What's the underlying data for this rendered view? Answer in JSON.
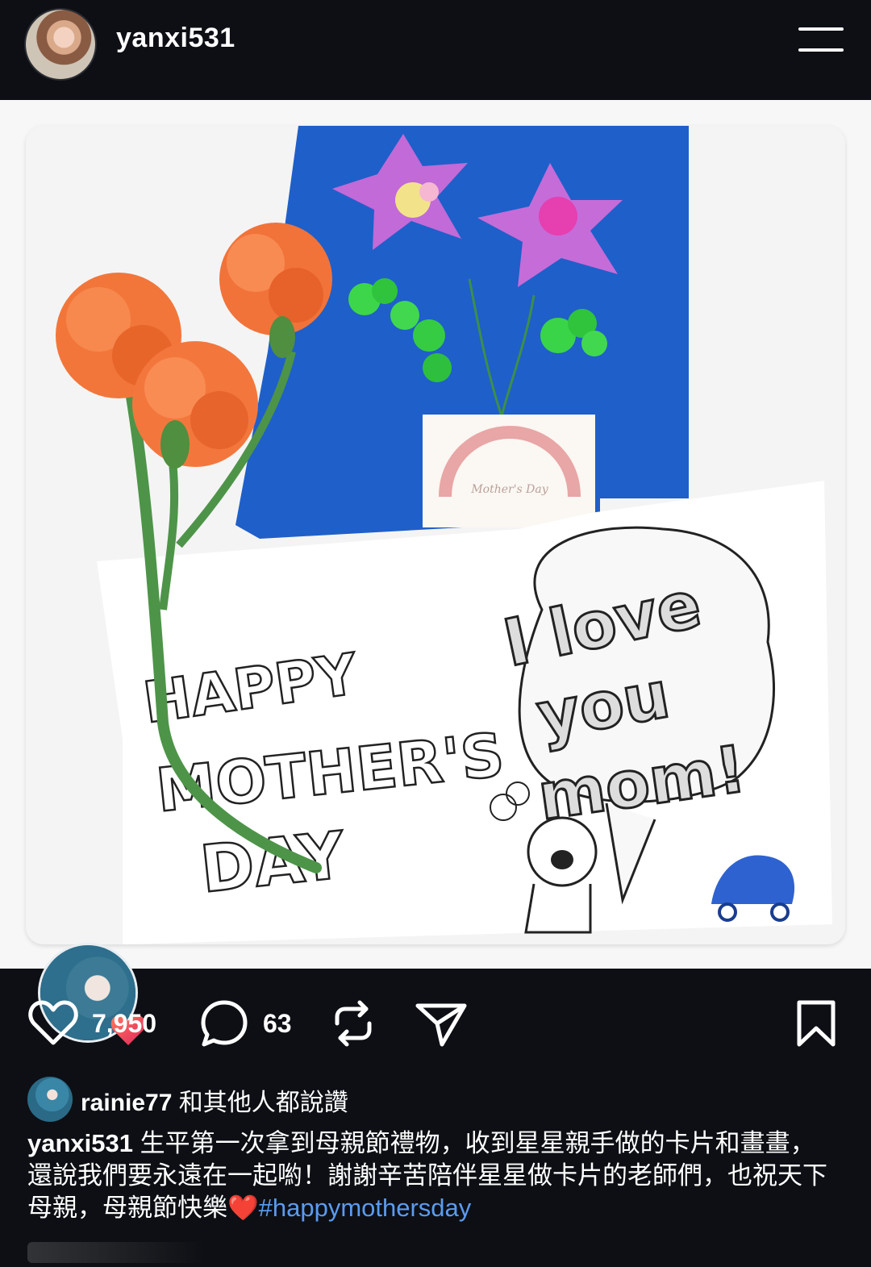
{
  "header": {
    "username": "yanxi531"
  },
  "post": {
    "image_alt_semantic": "photo",
    "card": {
      "drawing_text_left": "HAPPY MOTHER'S DAY",
      "drawing_text_right": "I love you, mom!",
      "small_card_text": "Mother's Day"
    }
  },
  "actions": {
    "likes": "7,950",
    "comments": "63"
  },
  "liked_by": {
    "user": "rainie77",
    "suffix": " 和其他人都說讚"
  },
  "caption": {
    "user": "yanxi531",
    "text": " 生平第一次拿到母親節禮物，收到星星親手做的卡片和畫畫，還說我們要永遠在一起喲！謝謝辛苦陪伴星星做卡片的老師們，也祝天下母親，母親節快樂",
    "emoji": "❤️",
    "hashtag": "#happymothersday"
  },
  "colors": {
    "background": "#0d0f14",
    "hashtag": "#5b9bf0",
    "heart": "#e0242f"
  }
}
